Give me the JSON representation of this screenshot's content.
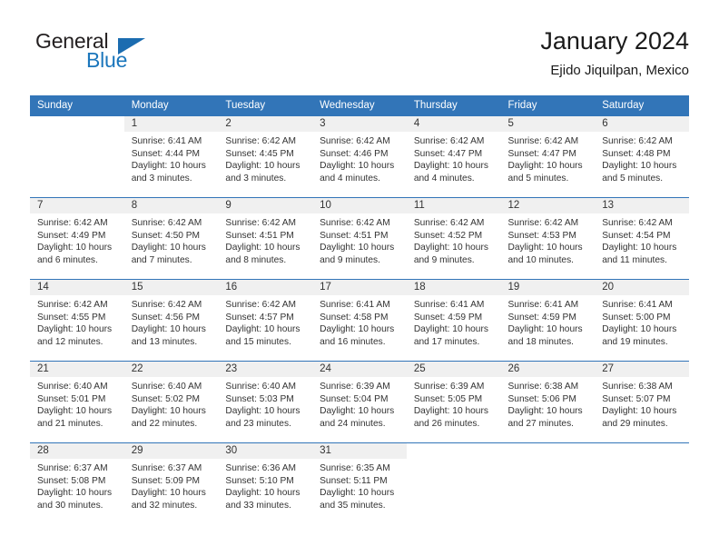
{
  "brand": {
    "name_part1": "General",
    "name_part2": "Blue",
    "accent_color": "#1b76bc",
    "triangle_icon": "triangle-icon"
  },
  "header": {
    "title": "January 2024",
    "subtitle": "Ejido Jiquilpan, Mexico"
  },
  "calendar": {
    "header_bg": "#3275b8",
    "daynum_bg": "#f0f0f0",
    "weekday_headers": [
      "Sunday",
      "Monday",
      "Tuesday",
      "Wednesday",
      "Thursday",
      "Friday",
      "Saturday"
    ],
    "weeks": [
      [
        {
          "day": "",
          "lines": []
        },
        {
          "day": "1",
          "lines": [
            "Sunrise: 6:41 AM",
            "Sunset: 4:44 PM",
            "Daylight: 10 hours",
            "and 3 minutes."
          ]
        },
        {
          "day": "2",
          "lines": [
            "Sunrise: 6:42 AM",
            "Sunset: 4:45 PM",
            "Daylight: 10 hours",
            "and 3 minutes."
          ]
        },
        {
          "day": "3",
          "lines": [
            "Sunrise: 6:42 AM",
            "Sunset: 4:46 PM",
            "Daylight: 10 hours",
            "and 4 minutes."
          ]
        },
        {
          "day": "4",
          "lines": [
            "Sunrise: 6:42 AM",
            "Sunset: 4:47 PM",
            "Daylight: 10 hours",
            "and 4 minutes."
          ]
        },
        {
          "day": "5",
          "lines": [
            "Sunrise: 6:42 AM",
            "Sunset: 4:47 PM",
            "Daylight: 10 hours",
            "and 5 minutes."
          ]
        },
        {
          "day": "6",
          "lines": [
            "Sunrise: 6:42 AM",
            "Sunset: 4:48 PM",
            "Daylight: 10 hours",
            "and 5 minutes."
          ]
        }
      ],
      [
        {
          "day": "7",
          "lines": [
            "Sunrise: 6:42 AM",
            "Sunset: 4:49 PM",
            "Daylight: 10 hours",
            "and 6 minutes."
          ]
        },
        {
          "day": "8",
          "lines": [
            "Sunrise: 6:42 AM",
            "Sunset: 4:50 PM",
            "Daylight: 10 hours",
            "and 7 minutes."
          ]
        },
        {
          "day": "9",
          "lines": [
            "Sunrise: 6:42 AM",
            "Sunset: 4:51 PM",
            "Daylight: 10 hours",
            "and 8 minutes."
          ]
        },
        {
          "day": "10",
          "lines": [
            "Sunrise: 6:42 AM",
            "Sunset: 4:51 PM",
            "Daylight: 10 hours",
            "and 9 minutes."
          ]
        },
        {
          "day": "11",
          "lines": [
            "Sunrise: 6:42 AM",
            "Sunset: 4:52 PM",
            "Daylight: 10 hours",
            "and 9 minutes."
          ]
        },
        {
          "day": "12",
          "lines": [
            "Sunrise: 6:42 AM",
            "Sunset: 4:53 PM",
            "Daylight: 10 hours",
            "and 10 minutes."
          ]
        },
        {
          "day": "13",
          "lines": [
            "Sunrise: 6:42 AM",
            "Sunset: 4:54 PM",
            "Daylight: 10 hours",
            "and 11 minutes."
          ]
        }
      ],
      [
        {
          "day": "14",
          "lines": [
            "Sunrise: 6:42 AM",
            "Sunset: 4:55 PM",
            "Daylight: 10 hours",
            "and 12 minutes."
          ]
        },
        {
          "day": "15",
          "lines": [
            "Sunrise: 6:42 AM",
            "Sunset: 4:56 PM",
            "Daylight: 10 hours",
            "and 13 minutes."
          ]
        },
        {
          "day": "16",
          "lines": [
            "Sunrise: 6:42 AM",
            "Sunset: 4:57 PM",
            "Daylight: 10 hours",
            "and 15 minutes."
          ]
        },
        {
          "day": "17",
          "lines": [
            "Sunrise: 6:41 AM",
            "Sunset: 4:58 PM",
            "Daylight: 10 hours",
            "and 16 minutes."
          ]
        },
        {
          "day": "18",
          "lines": [
            "Sunrise: 6:41 AM",
            "Sunset: 4:59 PM",
            "Daylight: 10 hours",
            "and 17 minutes."
          ]
        },
        {
          "day": "19",
          "lines": [
            "Sunrise: 6:41 AM",
            "Sunset: 4:59 PM",
            "Daylight: 10 hours",
            "and 18 minutes."
          ]
        },
        {
          "day": "20",
          "lines": [
            "Sunrise: 6:41 AM",
            "Sunset: 5:00 PM",
            "Daylight: 10 hours",
            "and 19 minutes."
          ]
        }
      ],
      [
        {
          "day": "21",
          "lines": [
            "Sunrise: 6:40 AM",
            "Sunset: 5:01 PM",
            "Daylight: 10 hours",
            "and 21 minutes."
          ]
        },
        {
          "day": "22",
          "lines": [
            "Sunrise: 6:40 AM",
            "Sunset: 5:02 PM",
            "Daylight: 10 hours",
            "and 22 minutes."
          ]
        },
        {
          "day": "23",
          "lines": [
            "Sunrise: 6:40 AM",
            "Sunset: 5:03 PM",
            "Daylight: 10 hours",
            "and 23 minutes."
          ]
        },
        {
          "day": "24",
          "lines": [
            "Sunrise: 6:39 AM",
            "Sunset: 5:04 PM",
            "Daylight: 10 hours",
            "and 24 minutes."
          ]
        },
        {
          "day": "25",
          "lines": [
            "Sunrise: 6:39 AM",
            "Sunset: 5:05 PM",
            "Daylight: 10 hours",
            "and 26 minutes."
          ]
        },
        {
          "day": "26",
          "lines": [
            "Sunrise: 6:38 AM",
            "Sunset: 5:06 PM",
            "Daylight: 10 hours",
            "and 27 minutes."
          ]
        },
        {
          "day": "27",
          "lines": [
            "Sunrise: 6:38 AM",
            "Sunset: 5:07 PM",
            "Daylight: 10 hours",
            "and 29 minutes."
          ]
        }
      ],
      [
        {
          "day": "28",
          "lines": [
            "Sunrise: 6:37 AM",
            "Sunset: 5:08 PM",
            "Daylight: 10 hours",
            "and 30 minutes."
          ]
        },
        {
          "day": "29",
          "lines": [
            "Sunrise: 6:37 AM",
            "Sunset: 5:09 PM",
            "Daylight: 10 hours",
            "and 32 minutes."
          ]
        },
        {
          "day": "30",
          "lines": [
            "Sunrise: 6:36 AM",
            "Sunset: 5:10 PM",
            "Daylight: 10 hours",
            "and 33 minutes."
          ]
        },
        {
          "day": "31",
          "lines": [
            "Sunrise: 6:35 AM",
            "Sunset: 5:11 PM",
            "Daylight: 10 hours",
            "and 35 minutes."
          ]
        },
        {
          "day": "",
          "lines": []
        },
        {
          "day": "",
          "lines": []
        },
        {
          "day": "",
          "lines": []
        }
      ]
    ]
  }
}
